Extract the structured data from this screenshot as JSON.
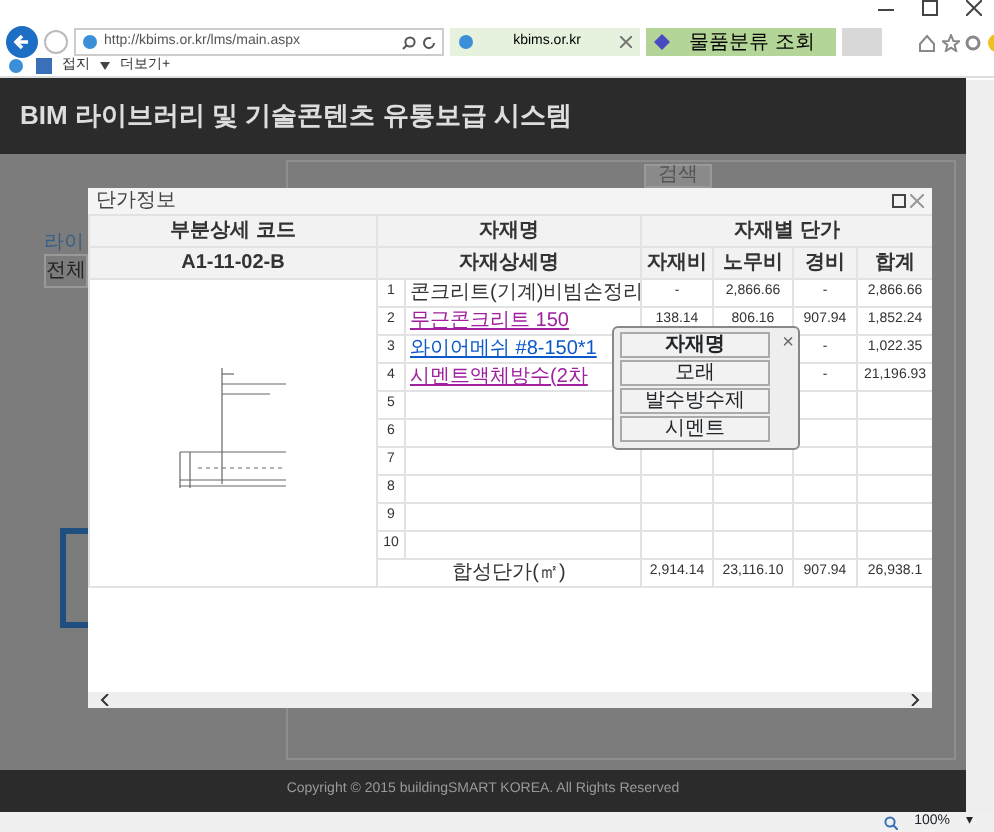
{
  "browser": {
    "address": "http://kbims.or.kr/lms/main.aspx",
    "tabs": [
      {
        "label": "kbims.or.kr",
        "selected": true
      },
      {
        "label": "물품분류 조회",
        "selected": false
      }
    ],
    "toolbar": [
      "접지",
      "더보기+"
    ]
  },
  "site_title": "BIM 라이브러리 및 기술콘텐츠 유통보급 시스템",
  "background": {
    "search_button": "검색",
    "tab_label": "라이",
    "select_value": "전체"
  },
  "modal": {
    "title": "단가정보",
    "code_header": "부분상세 코드",
    "code_value": "A1-11-02-B",
    "name_header": "자재명",
    "price_header": "자재별 단가",
    "detail_header": "자재상세명",
    "price_columns": [
      "자재비",
      "노무비",
      "경비",
      "합계"
    ],
    "rows": [
      {
        "no": "1",
        "kind": "text",
        "name": "콘크리트(기계)비빔손정리",
        "material": "-",
        "labor": "2,866.66",
        "expense": "-",
        "total": "2,866.66"
      },
      {
        "no": "2",
        "kind": "visited-link",
        "name": "무근콘크리트 150",
        "material": "138.14",
        "labor": "806.16",
        "expense": "907.94",
        "total": "1,852.24"
      },
      {
        "no": "3",
        "kind": "link",
        "name": "와이어메쉬 #8-150*1",
        "expense": "-",
        "total": "1,022.35"
      },
      {
        "no": "4",
        "kind": "visited-link",
        "name": "시멘트액체방수(2차",
        "expense": "-",
        "total": "21,196.93"
      },
      {
        "no": "5"
      },
      {
        "no": "6"
      },
      {
        "no": "7"
      },
      {
        "no": "8"
      },
      {
        "no": "9"
      },
      {
        "no": "10"
      }
    ],
    "sum": {
      "label": "합성단가(㎡)",
      "material": "2,914.14",
      "labor": "23,116.10",
      "expense": "907.94",
      "total": "26,938.1"
    }
  },
  "popup": {
    "header": "자재명",
    "close": "×",
    "items": [
      "모래",
      "발수방수제",
      "시멘트"
    ]
  },
  "footer": "Copyright © 2015 buildingSMART KOREA. All Rights Reserved",
  "status_bar": {
    "zoom": "100%",
    "caret": "▾"
  }
}
